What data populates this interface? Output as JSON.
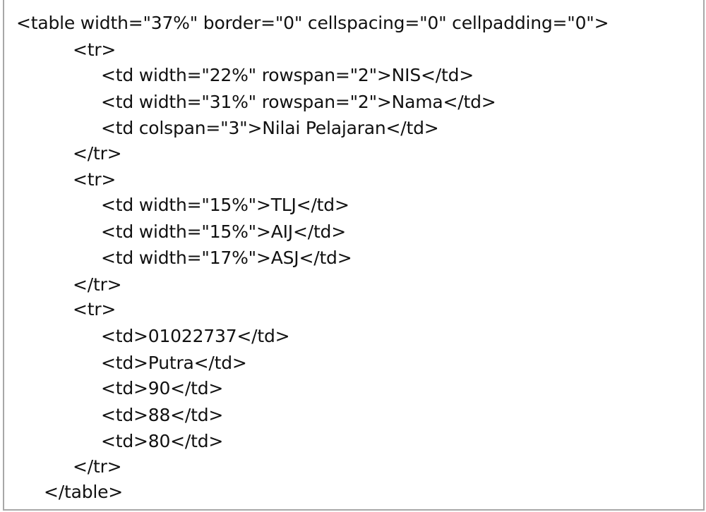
{
  "code_lines": [
    "<table width=\"37%\" border=\"0\" cellspacing=\"0\" cellpadding=\"0\">",
    "<tr>",
    "<td width=\"22%\" rowspan=\"2\">NIS</td>",
    "<td width=\"31%\" rowspan=\"2\">Nama</td>",
    "<td colspan=\"3\">Nilai Pelajaran</td>",
    "</tr>",
    "<tr>",
    "<td width=\"15%\">TLJ</td>",
    "<td width=\"15%\">AIJ</td>",
    "<td width=\"17%\">ASJ</td>",
    "</tr>",
    "<tr>",
    "<td>01022737</td>",
    "<td>Putra</td>",
    "<td>90</td>",
    "<td>88</td>",
    "<td>80</td>",
    "</tr>",
    "</table>"
  ]
}
